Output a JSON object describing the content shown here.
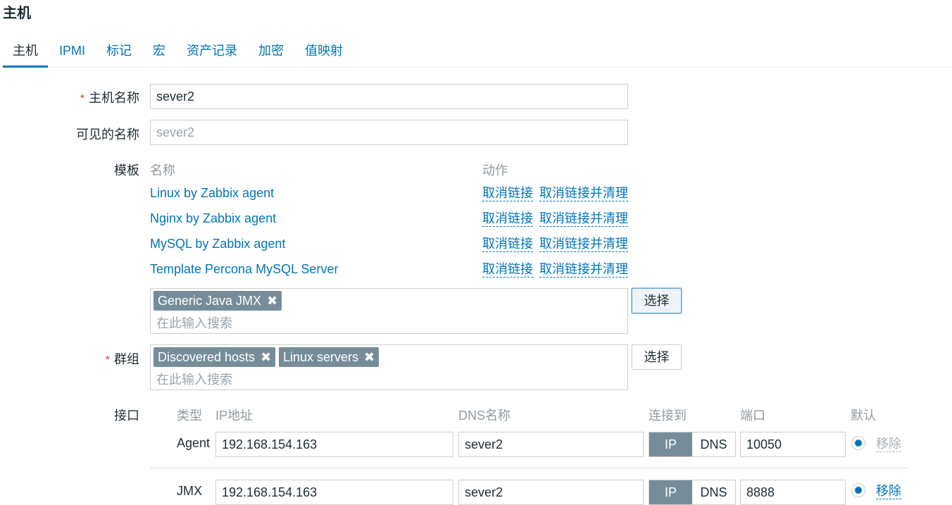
{
  "page": {
    "title": "主机"
  },
  "tabs": [
    {
      "label": "主机"
    },
    {
      "label": "IPMI"
    },
    {
      "label": "标记"
    },
    {
      "label": "宏"
    },
    {
      "label": "资产记录"
    },
    {
      "label": "加密"
    },
    {
      "label": "值映射"
    }
  ],
  "host_name": {
    "label": "主机名称",
    "value": "sever2"
  },
  "visible_name": {
    "label": "可见的名称",
    "placeholder": "sever2"
  },
  "templates": {
    "label": "模板",
    "col_name": "名称",
    "col_action": "动作",
    "items": [
      {
        "name": "Linux by Zabbix agent",
        "unlink": "取消链接",
        "unlink_clear": "取消链接并清理"
      },
      {
        "name": "Nginx by Zabbix agent",
        "unlink": "取消链接",
        "unlink_clear": "取消链接并清理"
      },
      {
        "name": "MySQL by Zabbix agent",
        "unlink": "取消链接",
        "unlink_clear": "取消链接并清理"
      },
      {
        "name": "Template Percona MySQL Server",
        "unlink": "取消链接",
        "unlink_clear": "取消链接并清理"
      }
    ],
    "chips": [
      {
        "label": "Generic Java JMX"
      }
    ],
    "search_placeholder": "在此输入搜索",
    "select_button": "选择"
  },
  "groups": {
    "label": "群组",
    "chips": [
      {
        "label": "Discovered hosts"
      },
      {
        "label": "Linux servers"
      }
    ],
    "search_placeholder": "在此输入搜索",
    "select_button": "选择"
  },
  "interfaces": {
    "label": "接口",
    "headers": {
      "type": "类型",
      "ip": "IP地址",
      "dns": "DNS名称",
      "connect": "连接到",
      "port": "端口",
      "default": "默认"
    },
    "rows": [
      {
        "type": "Agent",
        "ip": "192.168.154.163",
        "dns": "sever2",
        "ip_btn": "IP",
        "dns_btn": "DNS",
        "port": "10050",
        "remove": "移除",
        "remove_enabled": false
      },
      {
        "type": "JMX",
        "ip": "192.168.154.163",
        "dns": "sever2",
        "ip_btn": "IP",
        "dns_btn": "DNS",
        "port": "8888",
        "remove": "移除",
        "remove_enabled": true
      }
    ]
  },
  "icons": {
    "remove_chip": "close-x-icon"
  },
  "colors": {
    "link": "#0275b8",
    "chip": "#768d99",
    "required": "#e33734"
  }
}
